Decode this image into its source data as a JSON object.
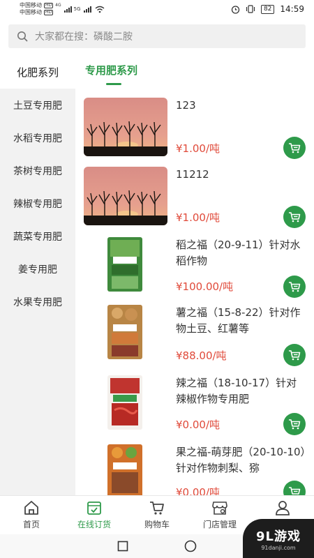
{
  "statusbar": {
    "carrier1": "中国移动",
    "carrier2": "中国移动",
    "hd": "HD",
    "net": "4G",
    "net2": "5G",
    "battery": "82",
    "time": "14:59"
  },
  "search": {
    "placeholder": "大家都在搜：磷酸二胺"
  },
  "categories": [
    "化肥系列",
    "土豆专用肥",
    "水稻专用肥",
    "茶树专用肥",
    "辣椒专用肥",
    "蔬菜专用肥",
    "姜专用肥",
    "水果专用肥"
  ],
  "active_tab": "专用肥系列",
  "products": [
    {
      "name": "123",
      "price": "¥1.00/吨",
      "thumb_icon": "tree-sunset-image"
    },
    {
      "name": "11212",
      "price": "¥1.00/吨",
      "thumb_icon": "tree-sunset-image"
    },
    {
      "name": "稻之福（20-9-11）针对水稻作物",
      "price": "¥100.00/吨",
      "thumb_icon": "fertilizer-bag-image",
      "bag_color": "#3f8a3c"
    },
    {
      "name": "薯之福（15-8-22）针对作物土豆、红薯等",
      "price": "¥88.00/吨",
      "thumb_icon": "fertilizer-bag-image",
      "bag_color": "#b88545"
    },
    {
      "name": "辣之福（18-10-17）针对辣椒作物专用肥",
      "price": "¥0.00/吨",
      "thumb_icon": "fertilizer-bag-image",
      "bag_color": "#c0342f"
    },
    {
      "name": "果之福-萌芽肥（20-10-10）针对作物刺梨、猕",
      "price": "¥0.00/吨",
      "thumb_icon": "fertilizer-bag-image",
      "bag_color": "#d0702a"
    }
  ],
  "bag_label": "绿台肥料",
  "bottom_nav": [
    {
      "label": "首页",
      "icon": "home-icon"
    },
    {
      "label": "在线订货",
      "icon": "order-icon"
    },
    {
      "label": "购物车",
      "icon": "cart-icon"
    },
    {
      "label": "门店管理",
      "icon": "store-icon"
    },
    {
      "label": "我的",
      "icon": "user-icon"
    }
  ],
  "watermark": {
    "main": "9L游戏",
    "sub": "91danji.com"
  },
  "colors": {
    "accent": "#2e9a4a",
    "price": "#e04a3a"
  }
}
